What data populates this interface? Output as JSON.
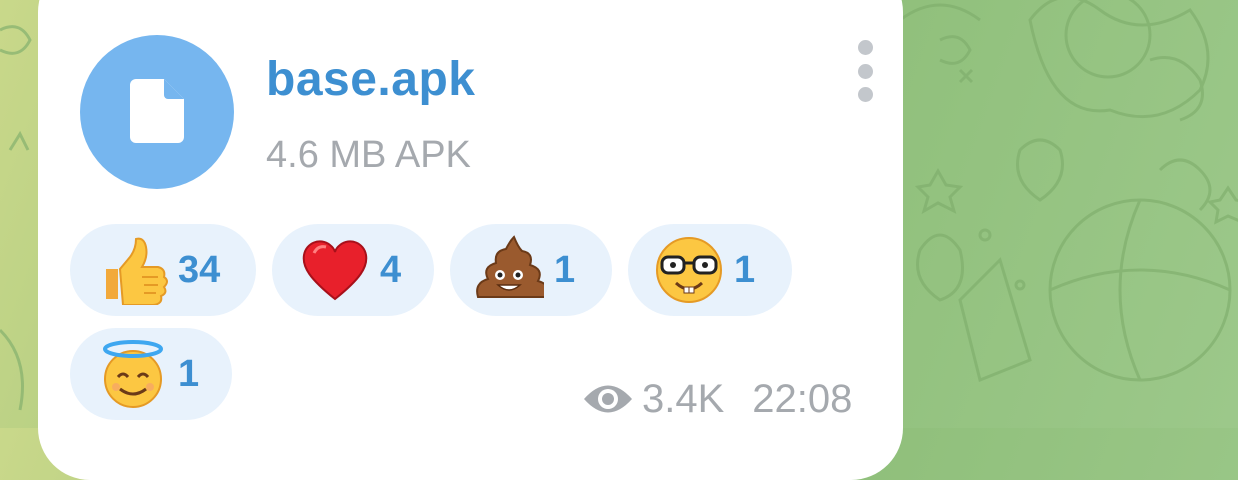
{
  "message": {
    "file_name": "base.apk",
    "file_meta": "4.6 MB APK",
    "views": "3.4K",
    "time": "22:08"
  },
  "reactions": [
    {
      "emoji": "thumbs-up",
      "count": "34"
    },
    {
      "emoji": "red-heart",
      "count": "4"
    },
    {
      "emoji": "pile-of-poo",
      "count": "1"
    },
    {
      "emoji": "nerd-face",
      "count": "1"
    },
    {
      "emoji": "smiling-face-with-halo",
      "count": "1"
    }
  ],
  "colors": {
    "accent": "#3d8fd1",
    "file_icon_bg": "#76b6ef",
    "reaction_bg": "#e8f2fc",
    "meta_text": "#a5a9ae"
  }
}
